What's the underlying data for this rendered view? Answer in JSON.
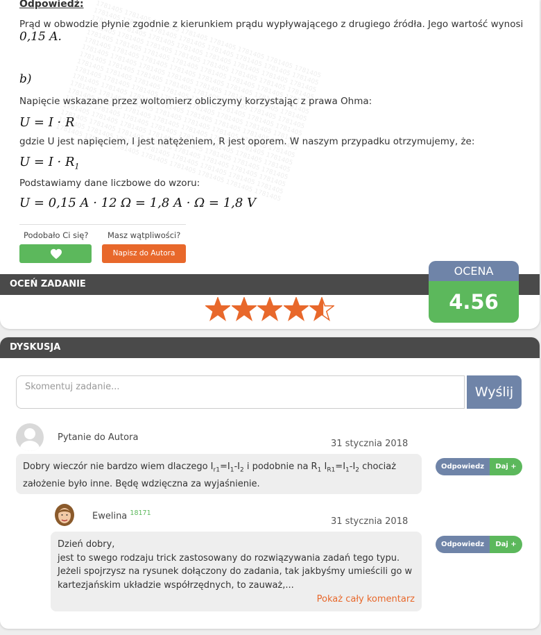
{
  "answer": {
    "label": "Odpowiedź:",
    "text": "Prąd w obwodzie płynie zgodnie z kierunkiem prądu wypływającego z drugiego źródła. Jego wartość wynosi",
    "value_math": "0,15 A."
  },
  "part_b": {
    "label": "b)",
    "intro": "Napięcie wskazane przez woltomierz obliczymy korzystając z prawa Ohma:",
    "formula1": "U = I · R",
    "explain": "gdzie U jest napięciem, I jest natężeniem, R jest oporem. W naszym przypadku otrzymujemy, że:",
    "formula2_main": "U = I · R",
    "formula2_sub": "1",
    "data_intro": "Podstawiamy dane liczbowe do wzoru:",
    "formula3": "U = 0,15 A · 12 Ω = 1,8 A · Ω = 1,8 V"
  },
  "feedback": {
    "liked_label": "Podobało Ci się?",
    "doubts_label": "Masz wątpliwości?",
    "author_button": "Napisz do Autora"
  },
  "rating": {
    "bar_title": "OCEŃ ZADANIE",
    "score_label": "OCENA",
    "score_value": "4.56",
    "stars_value": 4.56,
    "stars_max": 5,
    "star_color": "#e8682b"
  },
  "discussion": {
    "bar_title": "DYSKUSJA",
    "input_placeholder": "Skomentuj zadanie...",
    "send_label": "Wyślij",
    "comments": [
      {
        "author": "Pytanie do Autora",
        "date": "31 stycznia 2018",
        "reply_label": "Odpowiedz",
        "give_label": "Daj +"
      },
      {
        "author": "Ewelina",
        "points": "18171",
        "date": "31 stycznia 2018",
        "line1": "Dzień dobry,",
        "line2": "jest to swego rodzaju trick zastosowany do rozwiązywania zadań tego typu.",
        "line3": "Jeżeli spojrzysz na rysunek dołączony do zadania, tak jakbyśmy umieścili go w",
        "line4": "kartezjańskim układzie współrzędnych, to zauważ,...",
        "more_label": "Pokaż cały komentarz",
        "reply_label": "Odpowiedz",
        "give_label": "Daj +"
      }
    ],
    "q_part1": "Dobry wieczór nie bardzo wiem dlaczego I",
    "q_sub1": "r1",
    "q_part2": "=I",
    "q_sub2": "1",
    "q_part3": "-I",
    "q_sub3": "2",
    "q_part4": " i podobnie na R",
    "q_sub4": "1",
    "q_part5": " I",
    "q_sub5": "R1",
    "q_part6": "=I",
    "q_sub6": "1",
    "q_part7": "-I",
    "q_sub7": "2",
    "q_part8": " chociaż",
    "q_line2": "założenie było inne. Będę wdzięczna za wyjaśnienie."
  },
  "colors": {
    "green": "#5cb85c",
    "orange": "#e8682b",
    "blue_grey": "#6f84a8",
    "dark_bar": "#4a4a4a"
  }
}
